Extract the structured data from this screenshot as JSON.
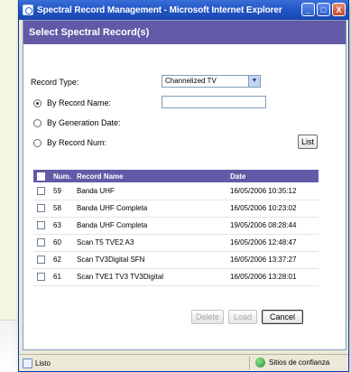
{
  "window": {
    "title": "Spectral Record Management - Microsoft Internet Explorer",
    "min_glyph": "_",
    "max_glyph": "□",
    "close_glyph": "X"
  },
  "dialog": {
    "header": "Select Spectral Record(s)",
    "record_type_label": "Record Type:",
    "record_type_value": "Channelized TV",
    "select_arrow": "▼",
    "by_name_label": "By Record Name:",
    "by_date_label": "By Generation Date:",
    "by_num_label": "By Record Num:",
    "list_button": "List",
    "selected_search": "by_name"
  },
  "table": {
    "headers": [
      "Num.",
      "Record Name",
      "Date"
    ],
    "rows": [
      {
        "num": "59",
        "name": "Banda UHF",
        "date": "16/05/2006 10:35:12"
      },
      {
        "num": "58",
        "name": "Banda UHF Completa",
        "date": "16/05/2006 10:23:02"
      },
      {
        "num": "63",
        "name": "Banda UHF Completa",
        "date": "19/05/2006 08:28:44"
      },
      {
        "num": "60",
        "name": "Scan T5 TVE2 A3",
        "date": "16/05/2006 12:48:47"
      },
      {
        "num": "62",
        "name": "Scan TV3Digital SFN",
        "date": "16/05/2006 13:37:27"
      },
      {
        "num": "61",
        "name": "Scan TVE1 TV3 TV3Digital",
        "date": "16/05/2006 13:28:01"
      }
    ]
  },
  "actions": {
    "delete": "Delete",
    "load": "Load",
    "cancel": "Cancel"
  },
  "statusbar": {
    "left": "Listo",
    "zone": "Sitios de confianza"
  },
  "colors": {
    "header_band": "#625aa6",
    "titlebar": "#2356c5",
    "window_bg": "#ece9d8"
  }
}
